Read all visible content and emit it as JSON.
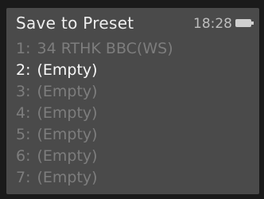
{
  "header": {
    "title": "Save to Preset",
    "clock": "18:28",
    "battery_icon": "battery-icon"
  },
  "presets": [
    {
      "number": "1:",
      "label": "34 RTHK BBC(WS)",
      "selected": false
    },
    {
      "number": "2:",
      "label": "(Empty)",
      "selected": true
    },
    {
      "number": "3:",
      "label": "(Empty)",
      "selected": false
    },
    {
      "number": "4:",
      "label": "(Empty)",
      "selected": false
    },
    {
      "number": "5:",
      "label": "(Empty)",
      "selected": false
    },
    {
      "number": "6:",
      "label": "(Empty)",
      "selected": false
    },
    {
      "number": "7:",
      "label": "(Empty)",
      "selected": false
    }
  ],
  "colors": {
    "screen_background": "#4a4a4a",
    "selected_text": "#f7f7f7",
    "unselected_text": "#7d7d7d"
  }
}
